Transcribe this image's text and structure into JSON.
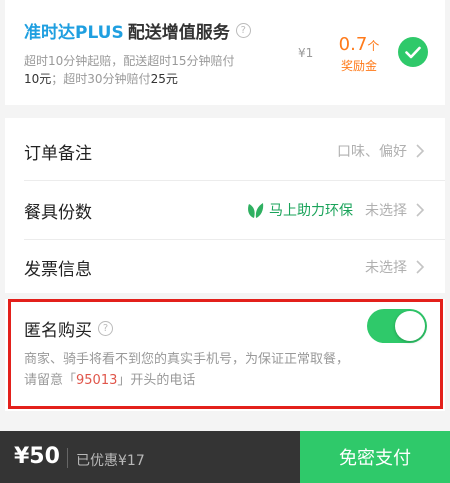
{
  "plus_service": {
    "brand": "准时达PLUS",
    "suffix": "配送增值服务",
    "description_line1": "超时10分钟起赔，配送超时15分钟赔付",
    "description_line2_amount1": "10元",
    "description_line2_mid": "；超时30分钟赔付",
    "description_line2_amount2": "25元",
    "price": "¥1",
    "reward_amount": "0.7",
    "reward_unit": "个",
    "reward_label": "奖励金",
    "selected": true
  },
  "options": {
    "remark_label": "订单备注",
    "remark_value": "口味、偏好",
    "tableware_label": "餐具份数",
    "eco_text": "马上助力环保",
    "tableware_value": "未选择",
    "invoice_label": "发票信息",
    "invoice_value": "未选择"
  },
  "anonymous": {
    "title": "匿名购买",
    "desc_line1": "商家、骑手将看不到您的真实手机号，为保证正常取餐，",
    "desc_prefix": "请留意「",
    "desc_number": "95013",
    "desc_suffix": "」开头的电话",
    "enabled": true
  },
  "bottom_bar": {
    "total": "¥50",
    "discount": "已优惠¥17",
    "pay_label": "免密支付"
  },
  "colors": {
    "brand_blue": "#1f9fe0",
    "accent_green": "#2fc96a",
    "reward_orange": "#ff7a1a",
    "highlight_red": "#e3201b"
  }
}
